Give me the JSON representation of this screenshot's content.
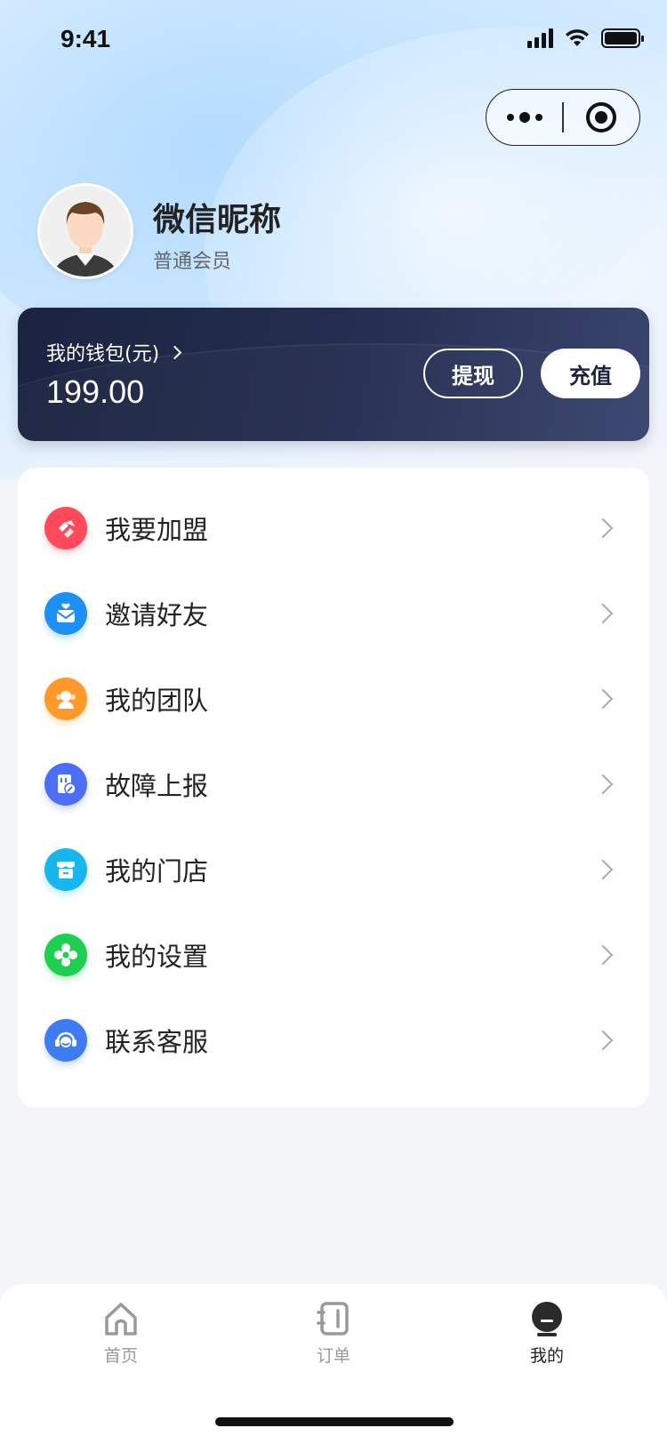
{
  "status_bar": {
    "time": "9:41"
  },
  "capsule": {
    "more_icon": "more-dots-icon",
    "close_icon": "target-icon"
  },
  "profile": {
    "nickname": "微信昵称",
    "level": "普通会员"
  },
  "wallet": {
    "title": "我的钱包(元)",
    "amount": "199.00",
    "withdraw_label": "提现",
    "recharge_label": "充值"
  },
  "menu": {
    "items": [
      {
        "label": "我要加盟",
        "icon": "handshake-icon",
        "color": "#ff4a5c"
      },
      {
        "label": "邀请好友",
        "icon": "envelope-heart-icon",
        "color": "#1e90f5"
      },
      {
        "label": "我的团队",
        "icon": "team-icon",
        "color": "#ff9a2a"
      },
      {
        "label": "故障上报",
        "icon": "fault-report-icon",
        "color": "#4c6ef5"
      },
      {
        "label": "我的门店",
        "icon": "store-icon",
        "color": "#17b6ee"
      },
      {
        "label": "我的设置",
        "icon": "settings-flower-icon",
        "color": "#1ecf52"
      },
      {
        "label": "联系客服",
        "icon": "headset-icon",
        "color": "#3f7cf4"
      }
    ]
  },
  "tabbar": {
    "tabs": [
      {
        "label": "首页",
        "icon": "home-icon",
        "active": false
      },
      {
        "label": "订单",
        "icon": "order-icon",
        "active": false
      },
      {
        "label": "我的",
        "icon": "profile-icon",
        "active": true
      }
    ]
  },
  "colors": {
    "wallet_bg": "#1b2340",
    "page_bg": "#f4f5f9",
    "tab_active": "#222222",
    "tab_inactive": "#999999"
  }
}
